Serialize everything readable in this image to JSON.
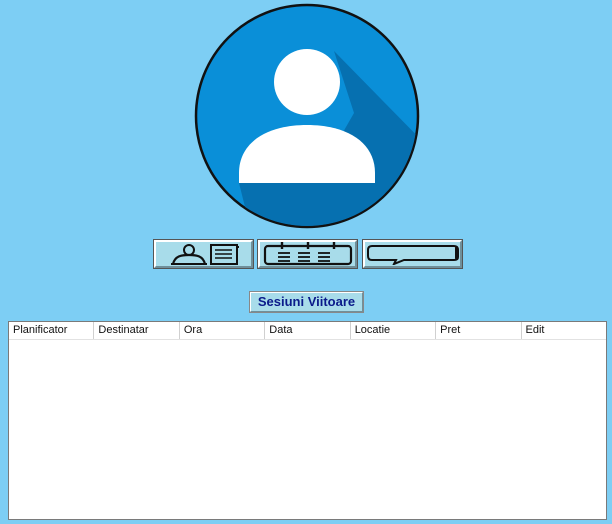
{
  "avatar": {
    "icon": "user-avatar-icon",
    "circle_color": "#0a8fd8",
    "shadow_color": "#0670b0",
    "figure_color": "#ffffff"
  },
  "nav_buttons": [
    {
      "icon": "contact-card-icon"
    },
    {
      "icon": "calendar-icon"
    },
    {
      "icon": "chat-bubble-icon"
    }
  ],
  "section_title": "Sesiuni Viitoare",
  "table": {
    "columns": [
      "Planificator",
      "Destinatar",
      "Ora",
      "Data",
      "Locatie",
      "Pret",
      "Edit"
    ],
    "rows": []
  },
  "colors": {
    "background": "#7dcef4",
    "button_face": "#a8dcea",
    "title_text": "#0a1a8a"
  }
}
